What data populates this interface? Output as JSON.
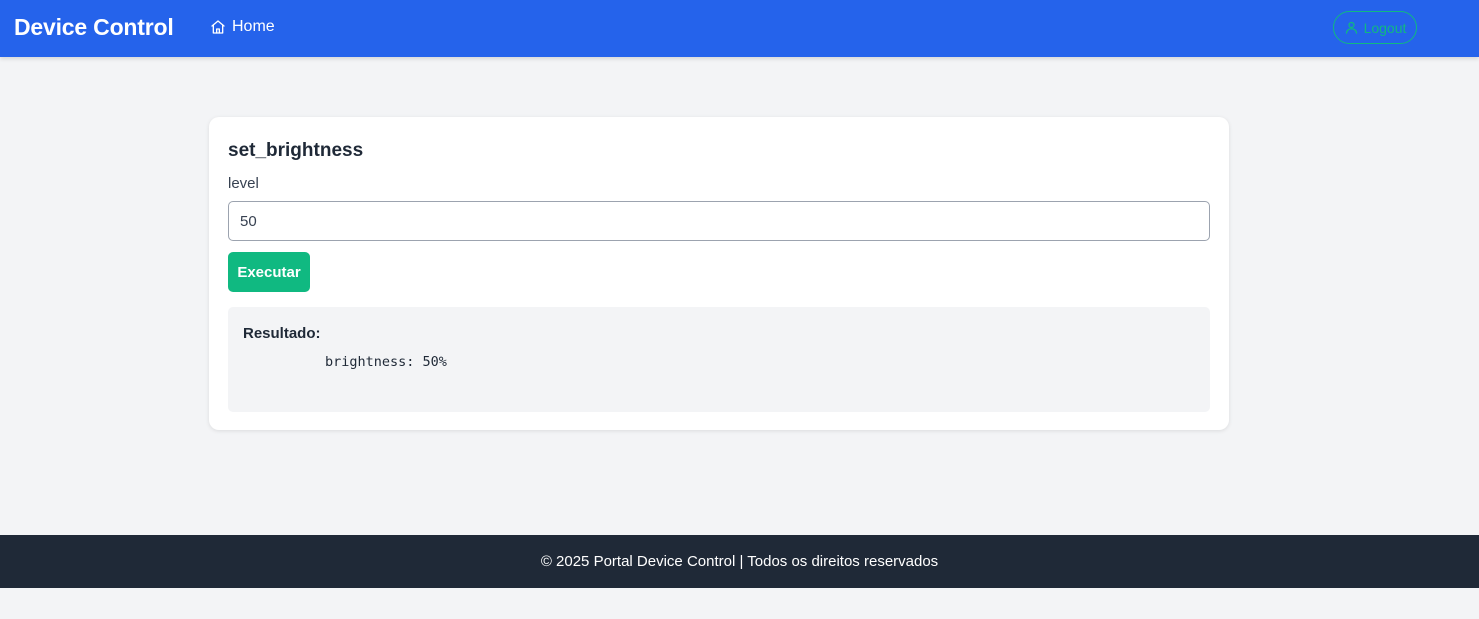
{
  "header": {
    "brand": "Device Control",
    "nav": {
      "home_label": "Home",
      "home_icon": "home-icon"
    },
    "logout": {
      "label": "Logout",
      "icon": "user-icon"
    }
  },
  "command": {
    "title": "set_brightness",
    "field_label": "level",
    "field_value": "50",
    "execute_label": "Executar",
    "result_label": "Resultado:",
    "result_output": "brightness: 50%"
  },
  "footer": {
    "text": "© 2025 Portal Device Control | Todos os direitos reservados"
  },
  "colors": {
    "navbar": "#2563eb",
    "accent_green": "#10b981",
    "footer": "#1f2937",
    "page_background": "#f3f4f6"
  }
}
